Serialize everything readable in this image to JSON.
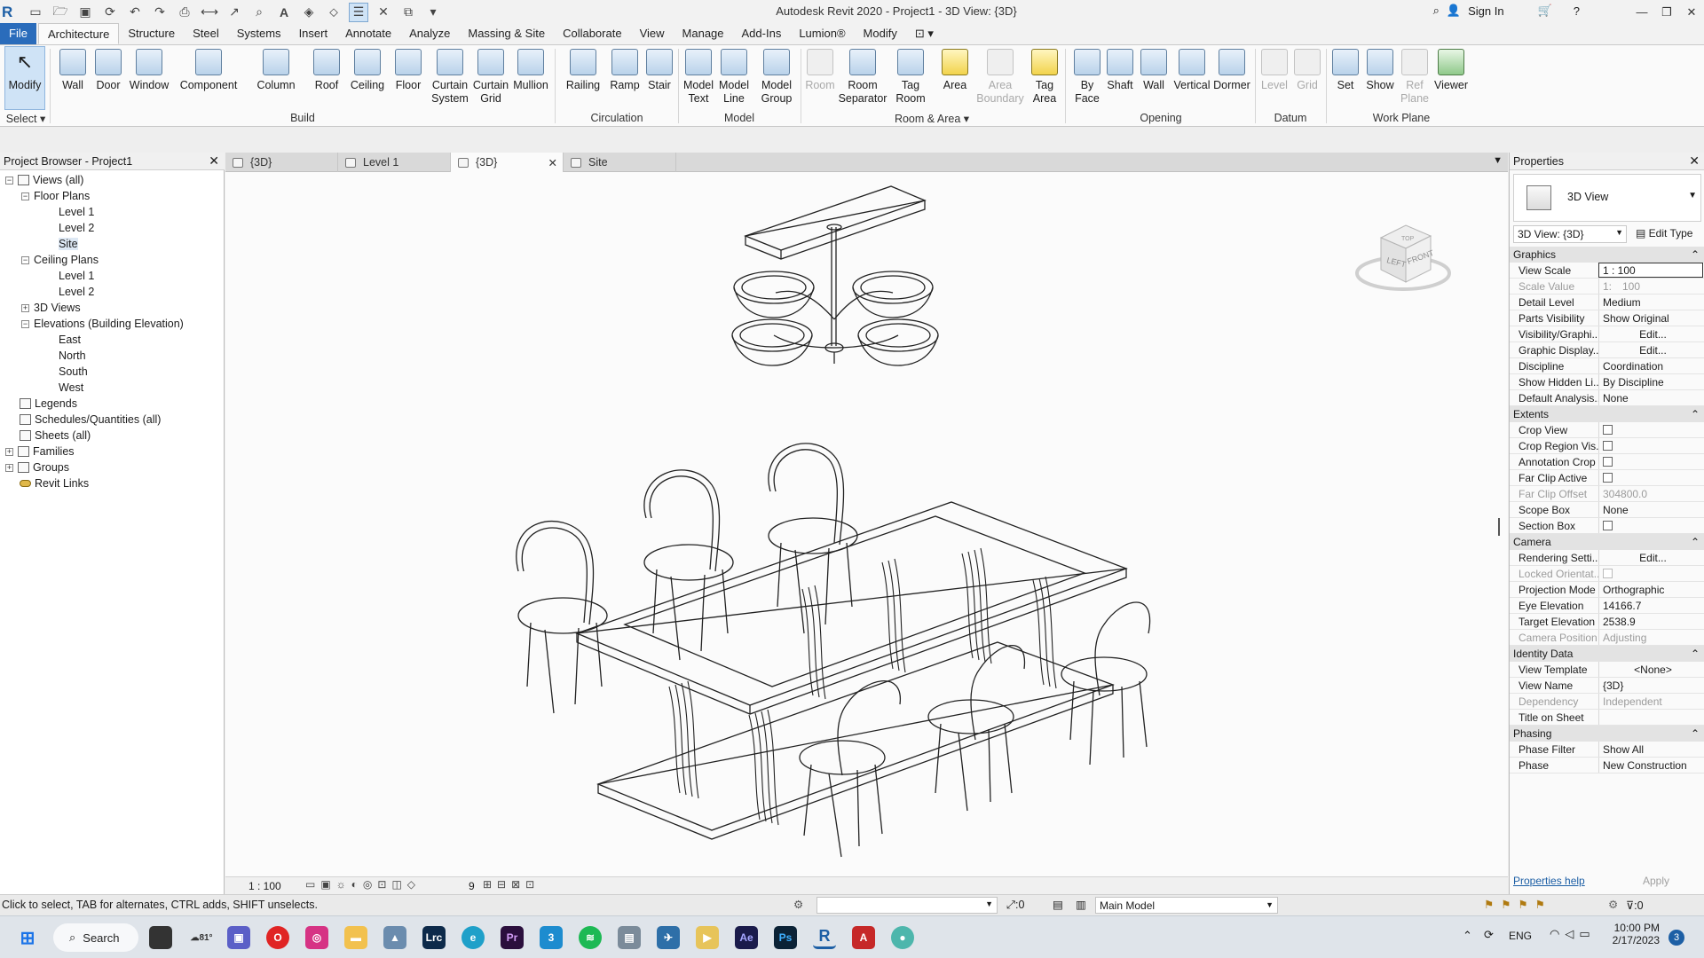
{
  "title": "Autodesk Revit 2020 - Project1 - 3D View: {3D}",
  "signin": "Sign In",
  "menu_tabs": [
    "File",
    "Architecture",
    "Structure",
    "Steel",
    "Systems",
    "Insert",
    "Annotate",
    "Analyze",
    "Massing & Site",
    "Collaborate",
    "View",
    "Manage",
    "Add-Ins",
    "Lumion®",
    "Modify"
  ],
  "ribbon": {
    "modify": "Modify",
    "select": "Select",
    "build_buttons": [
      "Wall",
      "Door",
      "Window",
      "Component",
      "Column",
      "Roof",
      "Ceiling",
      "Floor",
      "Curtain System",
      "Curtain Grid",
      "Mullion"
    ],
    "circulation_buttons": [
      "Railing",
      "Ramp",
      "Stair"
    ],
    "model_buttons": [
      "Model Text",
      "Model Line",
      "Model Group"
    ],
    "room_buttons": [
      "Room",
      "Room Separator",
      "Tag Room",
      "Area",
      "Area Boundary",
      "Tag Area"
    ],
    "opening_buttons": [
      "By Face",
      "Shaft",
      "Wall",
      "Vertical",
      "Dormer"
    ],
    "datum_buttons": [
      "Level",
      "Grid"
    ],
    "workplane_buttons": [
      "Set",
      "Show",
      "Ref Plane",
      "Viewer"
    ],
    "panels": [
      "Build",
      "Circulation",
      "Model",
      "Room & Area",
      "Opening",
      "Datum",
      "Work Plane"
    ]
  },
  "project_browser": {
    "title": "Project Browser - Project1",
    "rows": [
      {
        "label": "Views (all)",
        "tog": "−"
      },
      {
        "label": "Floor Plans",
        "tog": "−"
      },
      {
        "label": "Level 1"
      },
      {
        "label": "Level 2"
      },
      {
        "label": "Site"
      },
      {
        "label": "Ceiling Plans",
        "tog": "−"
      },
      {
        "label": "Level 1"
      },
      {
        "label": "Level 2"
      },
      {
        "label": "3D Views",
        "tog": "+"
      },
      {
        "label": "Elevations (Building Elevation)",
        "tog": "−"
      },
      {
        "label": "East"
      },
      {
        "label": "North"
      },
      {
        "label": "South"
      },
      {
        "label": "West"
      },
      {
        "label": "Legends"
      },
      {
        "label": "Schedules/Quantities (all)"
      },
      {
        "label": "Sheets (all)"
      },
      {
        "label": "Families",
        "tog": "+"
      },
      {
        "label": "Groups",
        "tog": "+"
      },
      {
        "label": "Revit Links"
      }
    ]
  },
  "view_tabs": [
    "{3D}",
    "Level 1",
    "{3D}",
    "Site"
  ],
  "viewcube": {
    "left": "LEFT",
    "front": "FRONT",
    "top": "TOP"
  },
  "view_scale_bar": "1 : 100",
  "view_bar_extra": "9",
  "properties": {
    "title": "Properties",
    "type": "3D View",
    "selector": "3D View: {3D}",
    "edit_type": "Edit Type",
    "groups": {
      "graphics": "Graphics",
      "extents": "Extents",
      "camera": "Camera",
      "identity": "Identity Data",
      "phasing": "Phasing"
    },
    "graphics": [
      {
        "k": "View Scale",
        "v": "1 : 100"
      },
      {
        "k": "Scale Value",
        "v": "100",
        "s": "1:"
      },
      {
        "k": "Detail Level",
        "v": "Medium"
      },
      {
        "k": "Parts Visibility",
        "v": "Show Original"
      },
      {
        "k": "Visibility/Graphi...",
        "v": "Edit..."
      },
      {
        "k": "Graphic Display...",
        "v": "Edit..."
      },
      {
        "k": "Discipline",
        "v": "Coordination"
      },
      {
        "k": "Show Hidden Li...",
        "v": "By Discipline"
      },
      {
        "k": "Default Analysis...",
        "v": "None"
      }
    ],
    "extents": [
      {
        "k": "Crop View",
        "v": ""
      },
      {
        "k": "Crop Region Vis...",
        "v": ""
      },
      {
        "k": "Annotation Crop",
        "v": ""
      },
      {
        "k": "Far Clip Active",
        "v": ""
      },
      {
        "k": "Far Clip Offset",
        "v": "304800.0"
      },
      {
        "k": "Scope Box",
        "v": "None"
      },
      {
        "k": "Section Box",
        "v": ""
      }
    ],
    "camera": [
      {
        "k": "Rendering Setti...",
        "v": "Edit..."
      },
      {
        "k": "Locked Orientat...",
        "v": ""
      },
      {
        "k": "Projection Mode",
        "v": "Orthographic"
      },
      {
        "k": "Eye Elevation",
        "v": "14166.7"
      },
      {
        "k": "Target Elevation",
        "v": "2538.9"
      },
      {
        "k": "Camera Position",
        "v": "Adjusting"
      }
    ],
    "identity": [
      {
        "k": "View Template",
        "v": "<None>"
      },
      {
        "k": "View Name",
        "v": "{3D}"
      },
      {
        "k": "Dependency",
        "v": "Independent"
      },
      {
        "k": "Title on Sheet",
        "v": ""
      }
    ],
    "phasing": [
      {
        "k": "Phase Filter",
        "v": "Show All"
      },
      {
        "k": "Phase",
        "v": "New Construction"
      }
    ],
    "help": "Properties help",
    "apply": "Apply"
  },
  "status": {
    "hint": "Click to select, TAB for alternates, CTRL adds, SHIFT unselects.",
    "count": ":0",
    "model": "Main Model",
    "filter_count": ":0"
  },
  "taskbar": {
    "search": "Search",
    "weather": "81°",
    "lang": "ENG",
    "time": "10:00 PM",
    "date": "2/17/2023",
    "badge": "3"
  }
}
